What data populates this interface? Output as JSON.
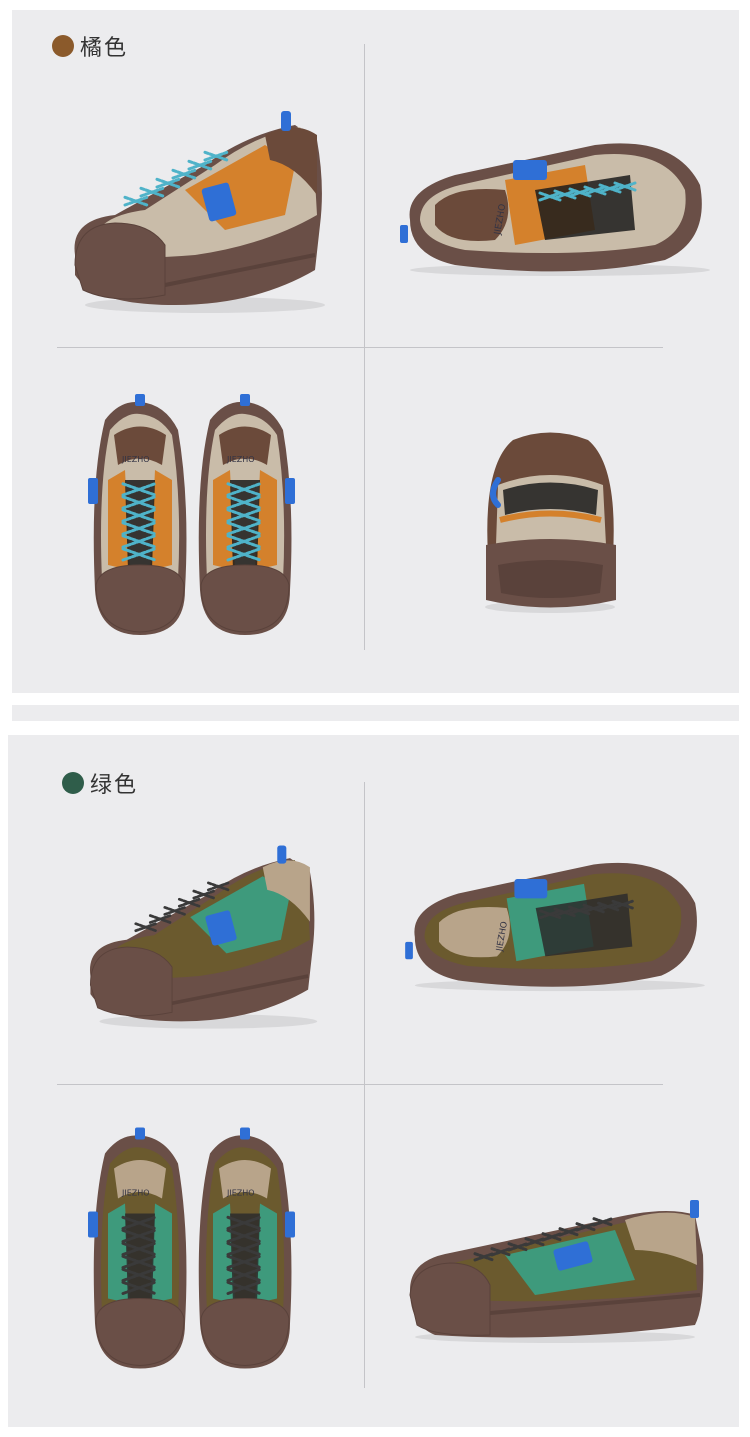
{
  "variants": [
    {
      "label": "橘色",
      "dot_color": "#8b5a2b",
      "colors": {
        "upper": "#c9bca9",
        "accent": "#d4812c",
        "collar": "#6b4a3a",
        "sole": "#6a4f47",
        "lace": "#4fb3c9",
        "tab": "#2f6fd6",
        "dark": "#1c1c1c"
      },
      "views": [
        "side-view",
        "top-side-view",
        "front-pair-view",
        "back-view"
      ]
    },
    {
      "label": "绿色",
      "dot_color": "#2f5d4a",
      "colors": {
        "upper": "#6b5a2e",
        "accent": "#3e9a7c",
        "collar": "#b8a48a",
        "sole": "#6a4f47",
        "lace": "#3a3a3a",
        "tab": "#2f6fd6",
        "dark": "#2b2b2b"
      },
      "views": [
        "side-view",
        "top-side-view",
        "front-pair-view",
        "outer-side-view"
      ]
    }
  ],
  "brand_text": "JIEZHO"
}
